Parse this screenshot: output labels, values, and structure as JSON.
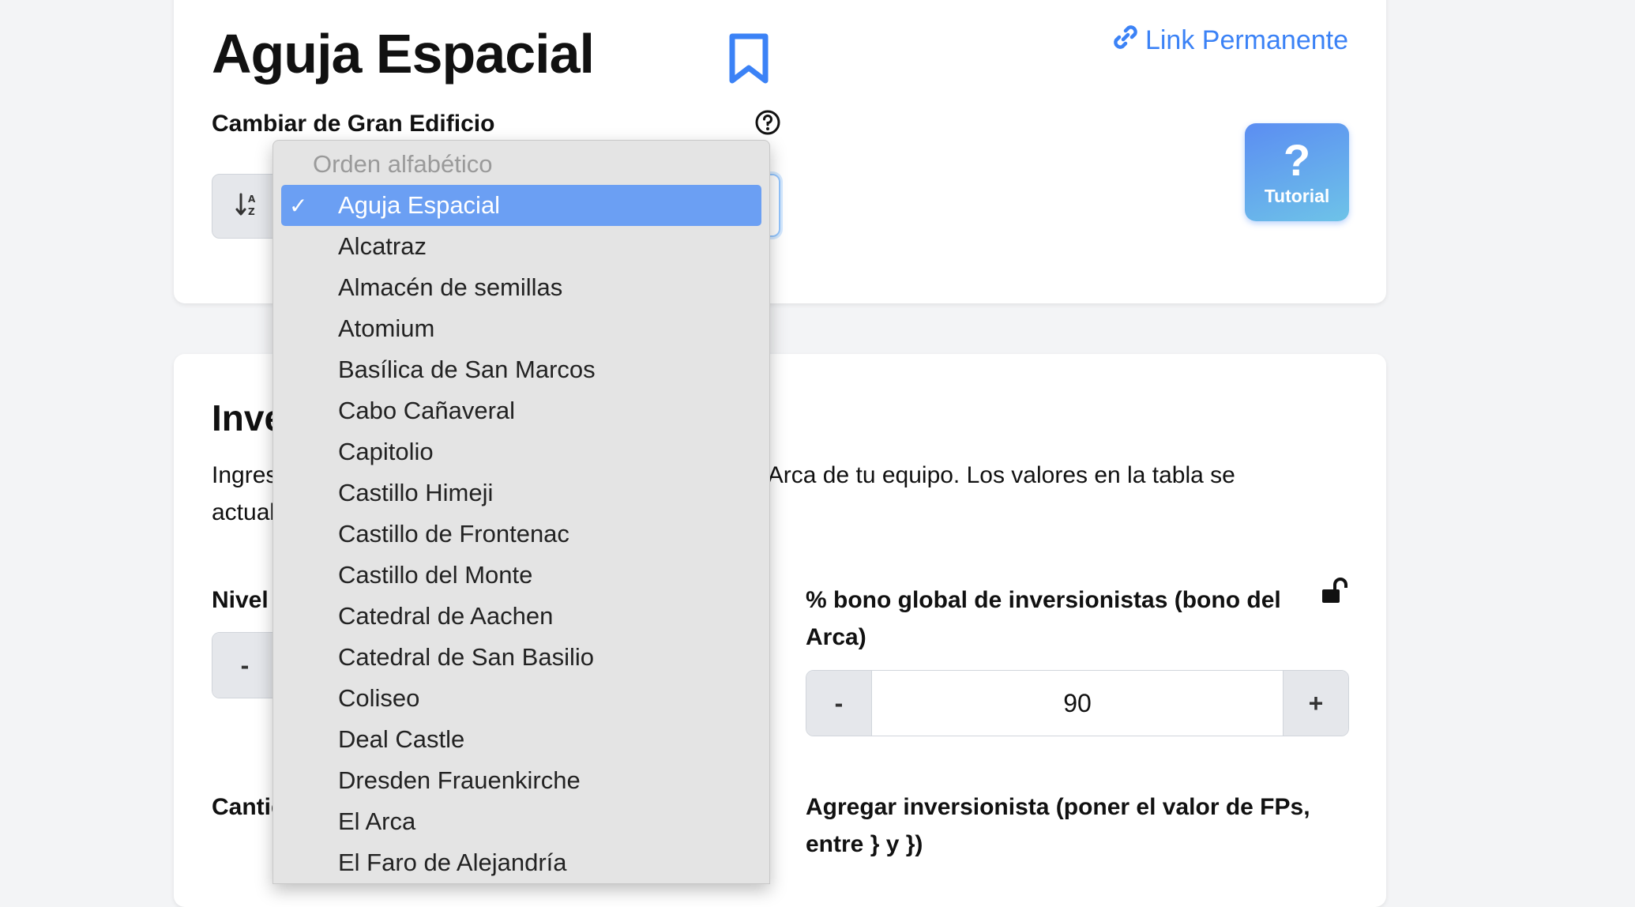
{
  "header": {
    "title": "Aguja Espacial",
    "permalink_label": "Link Permanente",
    "tutorial_label": "Tutorial",
    "change_gb_label": "Cambiar de Gran Edificio"
  },
  "dropdown": {
    "group_label": "Orden alfabético",
    "selected": "Aguja Espacial",
    "options": [
      "Aguja Espacial",
      "Alcatraz",
      "Almacén de semillas",
      "Atomium",
      "Basílica de San Marcos",
      "Cabo Cañaveral",
      "Capitolio",
      "Castillo Himeji",
      "Castillo de Frontenac",
      "Castillo del Monte",
      "Catedral de Aachen",
      "Catedral de San Basilio",
      "Coliseo",
      "Deal Castle",
      "Dresden Frauenkirche",
      "El Arca",
      "El Faro de Alejandría"
    ]
  },
  "main": {
    "section_title": "Inversionistas",
    "description": "Ingresa el nivel del Gran Edificio y el bono global del Arca de tu equipo. Los valores en la tabla se actualizan automáticamente.",
    "level_label": "Nivel",
    "arc_bonus_label": "% bono global de inversionistas (bono del Arca)",
    "arc_bonus_value": "90",
    "minus_label": "-",
    "plus_label": "+",
    "fp_quantity_label": "Cantidad de FPs propios",
    "add_investor_label": "Agregar inversionista (poner el valor de FPs, entre } y })"
  },
  "colors": {
    "accent": "#3b82f6",
    "selected_option": "#6b9ff3",
    "tutorial_gradient_start": "#5b8df2",
    "tutorial_gradient_end": "#6ec3e8"
  },
  "icons": [
    "bookmark-icon",
    "link-icon",
    "question-circle-icon",
    "sort-alpha-icon",
    "unlock-icon"
  ]
}
